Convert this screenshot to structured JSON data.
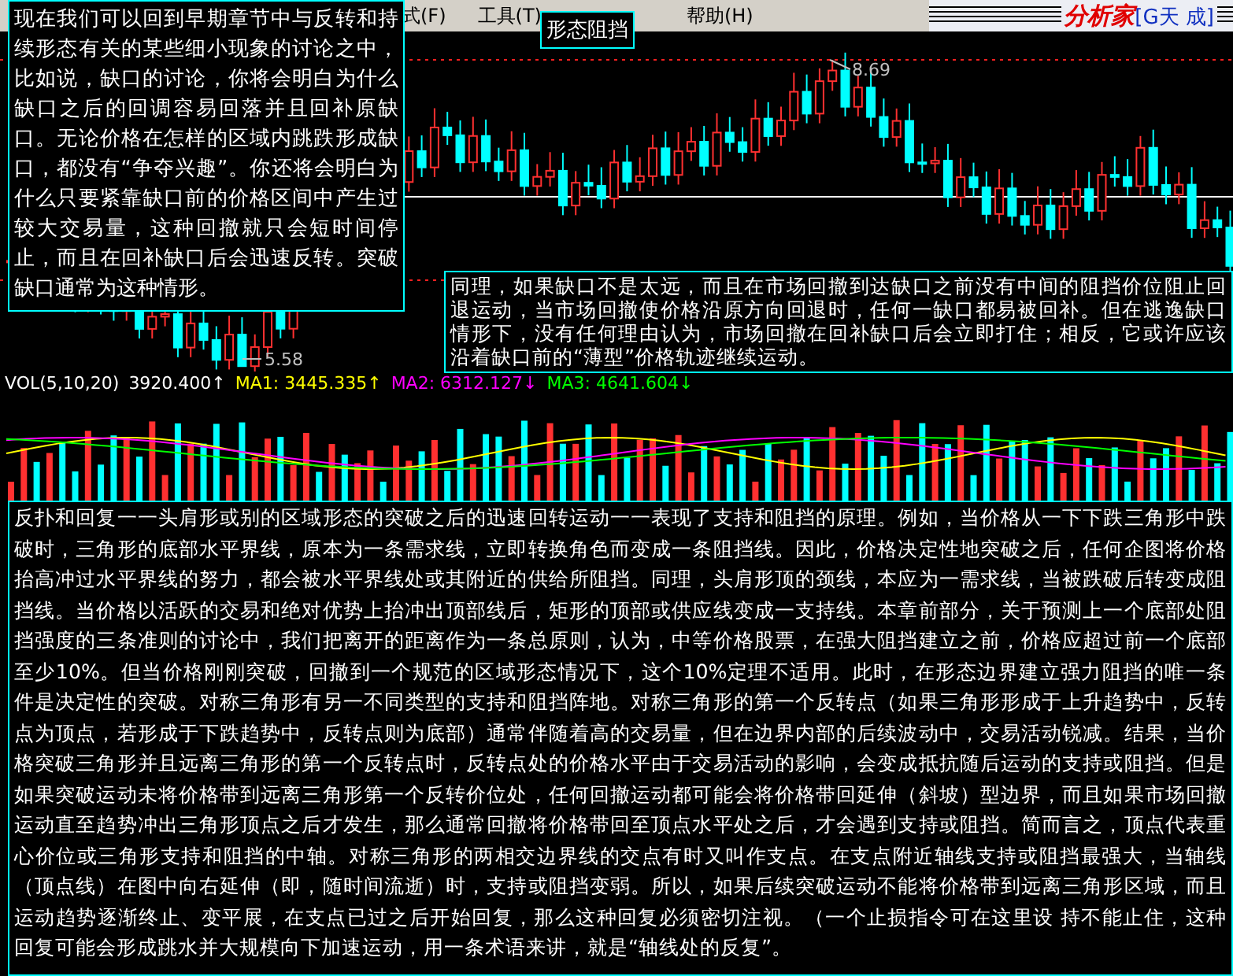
{
  "menu": {
    "items": [
      {
        "label": "式(F)"
      },
      {
        "label": "工具(T)"
      },
      {
        "label": "帮助(H)"
      }
    ]
  },
  "logo": {
    "brand": "分析家",
    "edition": "[G天 成]"
  },
  "price_chart": {
    "high_label": "8.69",
    "low_label": "5.58"
  },
  "volume_panel": {
    "indicator": "VOL(5,10,20)",
    "value": "3920.400↑",
    "lines": [
      {
        "label": "MA1: 3445.335↑",
        "color": "#ffff00"
      },
      {
        "label": "MA2: 6312.127↓",
        "color": "#ff00ff"
      },
      {
        "label": "MA3: 4641.604↓",
        "color": "#00ff00"
      }
    ]
  },
  "tooltip": {
    "title": "形态阻挡"
  },
  "notes": [
    {
      "kind": "left",
      "text": "现在我们可以回到早期章节中与反转和持续形态有关的某些细小现象的讨论之中，比如说，缺口的讨论，你将会明白为什么缺口之后的回调容易回落并且回补原缺口。无论价格在怎样的区域内跳跌形成缺口，都没有“争夺兴趣”。你还将会明白为什么只要紧靠缺口前的价格区间中产生过较大交易量，这种回撤就只会短时间停止，而且在回补缺口后会迅速反转。突破缺口通常为这种情形。"
    },
    {
      "kind": "middle",
      "text": "同理，如果缺口不是太远，而且在市场回撤到达缺口之前没有中间的阻挡价位阻止回退运动，当市场回撤使价格沿原方向回退时，任何一缺口都易被回补。但在逃逸缺口情形下，没有任何理由认为，市场回撤在回补缺口后会立即打住；相反，它或许应该沿着缺口前的“薄型”价格轨迹继续运动。"
    },
    {
      "kind": "bottom",
      "text": "反扑和回复一一头肩形或别的区域形态的突破之后的迅速回转运动一一表现了支持和阻挡的原理。例如，当价格从一下下跌三角形中跌破时，三角形的底部水平界线，原本为一条需求线，立即转换角色而变成一条阻挡线。因此，价格决定性地突破之后，任何企图将价格抬高冲过水平界线的努力，都会被水平界线处或其附近的供给所阻挡。同理，头肩形顶的颈线，本应为一需求线，当被跌破后转变成阻挡线。当价格以活跃的交易和绝对优势上抬冲出顶部线后，矩形的顶部或供应线变成一支持线。本章前部分，关于预测上一个底部处阻挡强度的三条准则的讨论中，我们把离开的距离作为一条总原则，认为，中等价格股票，在强大阻挡建立之前，价格应超过前一个底部至少10%。但当价格刚刚突破，回撤到一个规范的区域形态情况下，这个10%定理不适用。此时，在形态边界建立强力阻挡的唯一条件是决定性的突破。对称三角形有另一不同类型的支持和阻挡阵地。对称三角形的第一个反转点（如果三角形形成于上升趋势中，反转点为顶点，若形成于下跌趋势中，反转点则为底部）通常伴随着高的交易量，但在边界内部的后续波动中，交易活动锐减。结果，当价格突破三角形并且远离三角形的第一个反转点时，反转点处的价格水平由于交易活动的影响，会变成抵抗随后运动的支持或阻挡。但是如果突破运动未将价格带到远离三角形第一个反转价位处，任何回撤运动都可能会将价格带回延伸（斜坡）型边界，而且如果市场回撤运动直至趋势冲出三角形顶点之后才发生，那么通常回撤将价格带回至顶点水平处之后，才会遇到支持或阻挡。简而言之，顶点代表重心价位或三角形支持和阻挡的中轴。对称三角形的两相交边界线的交点有时又叫作支点。在支点附近轴线支持或阻挡最强大，当轴线（顶点线）在图中向右延伸（即，随时间流逝）时，支持或阻挡变弱。所以，如果后续突破运动不能将价格带到远离三角形区域，而且运动趋势逐渐终止、变平展，在支点已过之后开始回复，那么这种回复必须密切注视。（一个止损指令可在这里设 持不能止住，这种回复可能会形成跳水并大规模向下加速运动，用一条术语来讲，就是“轴线处的反复”。"
    }
  ]
}
